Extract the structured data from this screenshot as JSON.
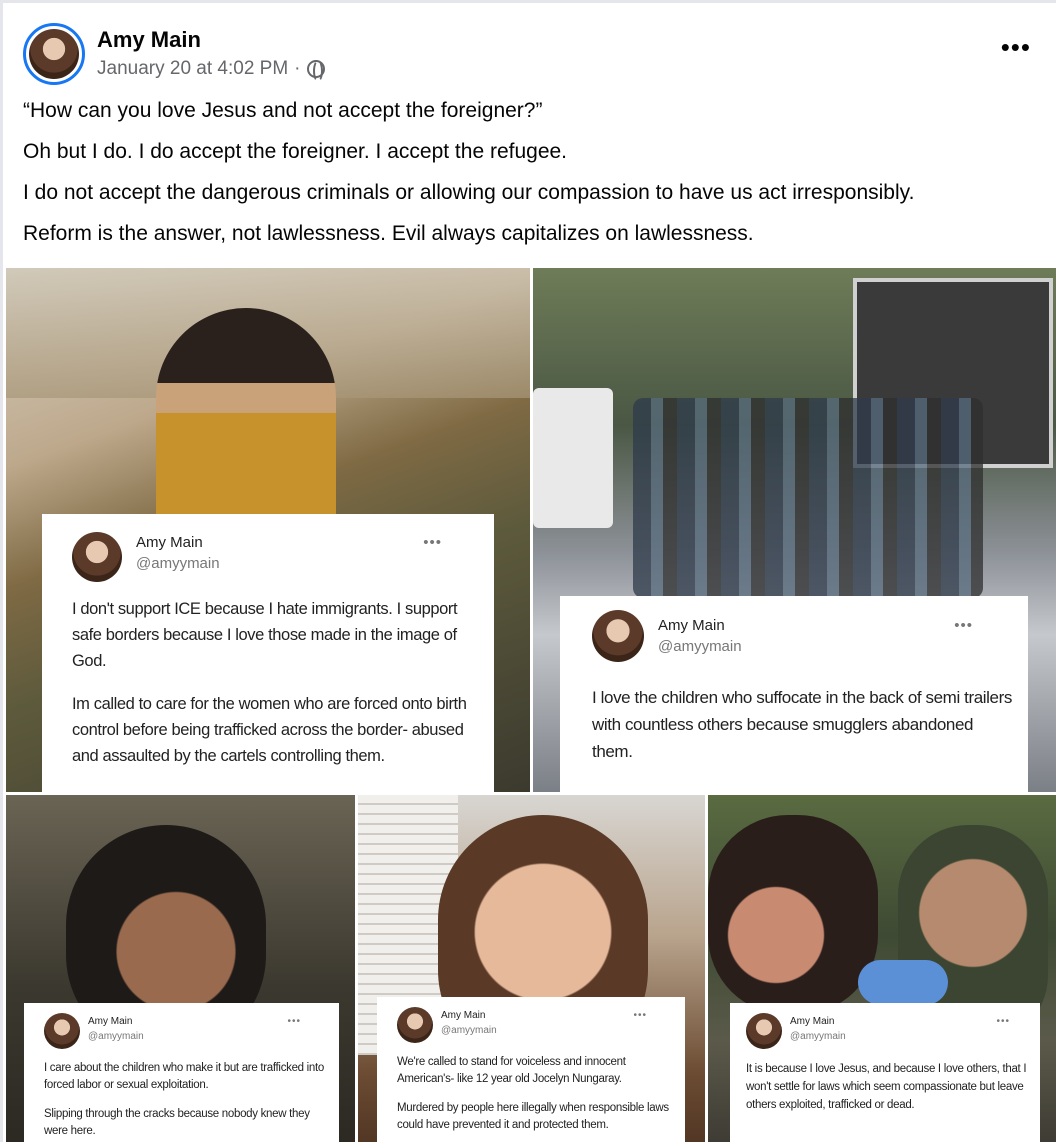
{
  "post": {
    "author": "Amy Main",
    "timestamp": "January 20 at 4:02 PM",
    "separator": "·",
    "audience_icon": "globe-icon",
    "more_label": "•••",
    "paragraphs": [
      "“How can you love Jesus and not accept the foreigner?”",
      "Oh but I do. I do accept the foreigner. I accept the refugee.",
      "I do not accept the dangerous criminals or allowing our compassion to have us act irresponsibly.",
      "Reform is the answer, not lawlessness. Evil always capitalizes on lawlessness."
    ]
  },
  "colors": {
    "avatar_ring": "#1877f2",
    "meta_text": "#65676b",
    "divider": "#e4e6eb"
  },
  "cards": [
    {
      "name": "Amy Main",
      "handle": "@amyymain",
      "more": "•••",
      "paragraphs": [
        "I don't support ICE because I hate immigrants. I support safe borders because I love those made in the image of God.",
        "Im called to care for the women who are forced onto birth control before being trafficked across the border- abused and assaulted by the cartels controlling them."
      ]
    },
    {
      "name": "Amy Main",
      "handle": "@amyymain",
      "more": "•••",
      "paragraphs": [
        "I love the children who suffocate in the back of semi trailers with countless others  because smugglers abandoned them."
      ]
    },
    {
      "name": "Amy Main",
      "handle": "@amyymain",
      "more": "•••",
      "paragraphs": [
        "I care about the children who make it but are trafficked into forced labor or sexual exploitation.",
        "Slipping through the cracks because nobody knew they were here."
      ]
    },
    {
      "name": "Amy Main",
      "handle": "@amyymain",
      "more": "•••",
      "paragraphs": [
        "We're called to  stand for voiceless and innocent American's- like 12 year old Jocelyn Nungaray.",
        "Murdered by people here illegally when responsible laws could have prevented it and protected them."
      ]
    },
    {
      "name": "Amy Main",
      "handle": "@amyymain",
      "more": "•••",
      "paragraphs": [
        "It is because I love Jesus, and because I love others, that I won't settle for laws which seem compassionate but leave others exploited, trafficked or dead."
      ]
    }
  ]
}
